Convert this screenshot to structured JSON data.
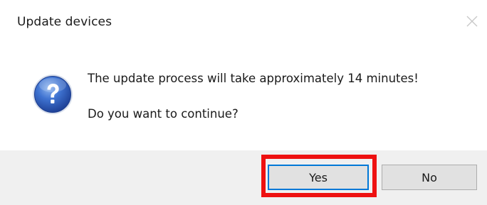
{
  "window": {
    "title": "Update devices",
    "close_icon": "close-icon"
  },
  "message": {
    "icon": "question-icon",
    "line1": "The update process will take approximately 14 minutes!",
    "line2": "Do you want to continue?"
  },
  "buttons": {
    "yes_label": "Yes",
    "no_label": "No"
  },
  "annotation": {
    "highlight_color": "#ee1111",
    "highlighted": "yes-button"
  },
  "colors": {
    "footer_bg": "#f0f0f0",
    "button_bg": "#e1e1e1",
    "focus_border": "#0078d7",
    "icon_blue": "#2a5bb8"
  }
}
